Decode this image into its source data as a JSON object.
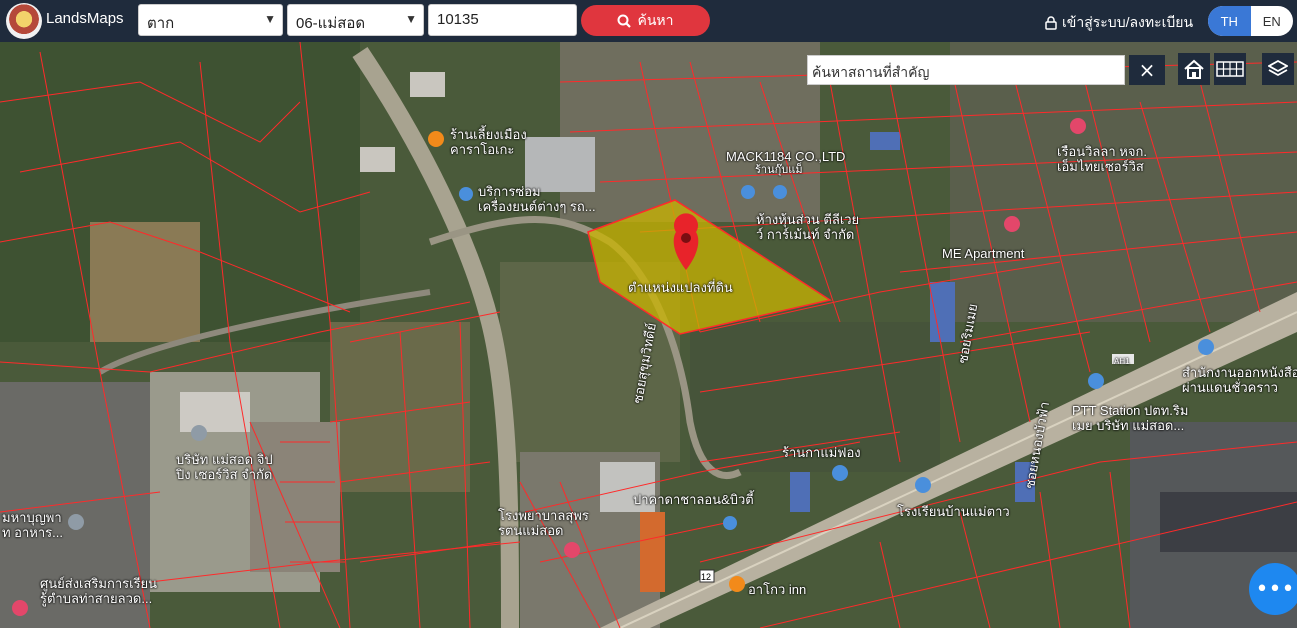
{
  "header": {
    "brand": "LandsMaps",
    "province": "ตาก",
    "district": "06-แม่สอด",
    "parcel_number": "10135",
    "search_label": "ค้นหา",
    "login_label": "เข้าสู่ระบบ/ลงทะเบียน",
    "lang_th": "TH",
    "lang_en": "EN",
    "accent_color": "#e0363e",
    "bar_color": "#1f2b3c"
  },
  "map": {
    "place_search_placeholder": "ค้นหาสถานที่สำคัญ",
    "clear_label": "×",
    "parcel_label": "ตำแหน่งแปลงที่ดิน",
    "parcel_fill_color": "#c9b400",
    "boundary_color": "#ff2a2a",
    "labels": {
      "karaoke": "ร้านเลี้ยงเมือง\nคาราโอเกะ",
      "repair": "บริการซ่อม\nเครื่องยนต์ต่างๆ รถ...",
      "mack": "MACK1184 CO.,LTD",
      "mack_sub": "ร้านกุ๊บแม็",
      "partnership": "ห้างหุ้นส่วน ตีลีเวย\nว์ การ์เม้นท์ จำกัด",
      "apartment": "ME Apartment",
      "guesthouse": "เรือนวิลลา หจก.\nเอ็มไทยเซอร์วิส",
      "customs": "สำนักงานออกหนังสือ\nผ่านแดนชั่วคราว",
      "ptt": "PTT Station ปตท.ริม\nเมย บริษัท แม่สอด...",
      "soi1": "ซอยสุขุมวิทดีย์",
      "soi2": "ซอยริมเมย",
      "soi3": "ซอยหนองบัวฟ้า",
      "shop": "ร้านกาแม่ฟอง",
      "company": "บริษัท แม่สอด จิป\nปิง เซอร์วิส จำกัด",
      "pizza": "ปาคาดาชาลอน&บิวตี้",
      "hospital": "โรงพยาบาลสุพร\nรตนแม่สอด",
      "school": "โรงเรียนบ้านแม่ตาว",
      "mahapun": "มหาบุญพา\nท อาหาร...",
      "learning": "ศูนย์ส่งเสริมการเรียน\nรู้ตำบลท่าสายลวด...",
      "food": "อาโกว inn",
      "route12": "12",
      "ah1": "AH1"
    }
  }
}
